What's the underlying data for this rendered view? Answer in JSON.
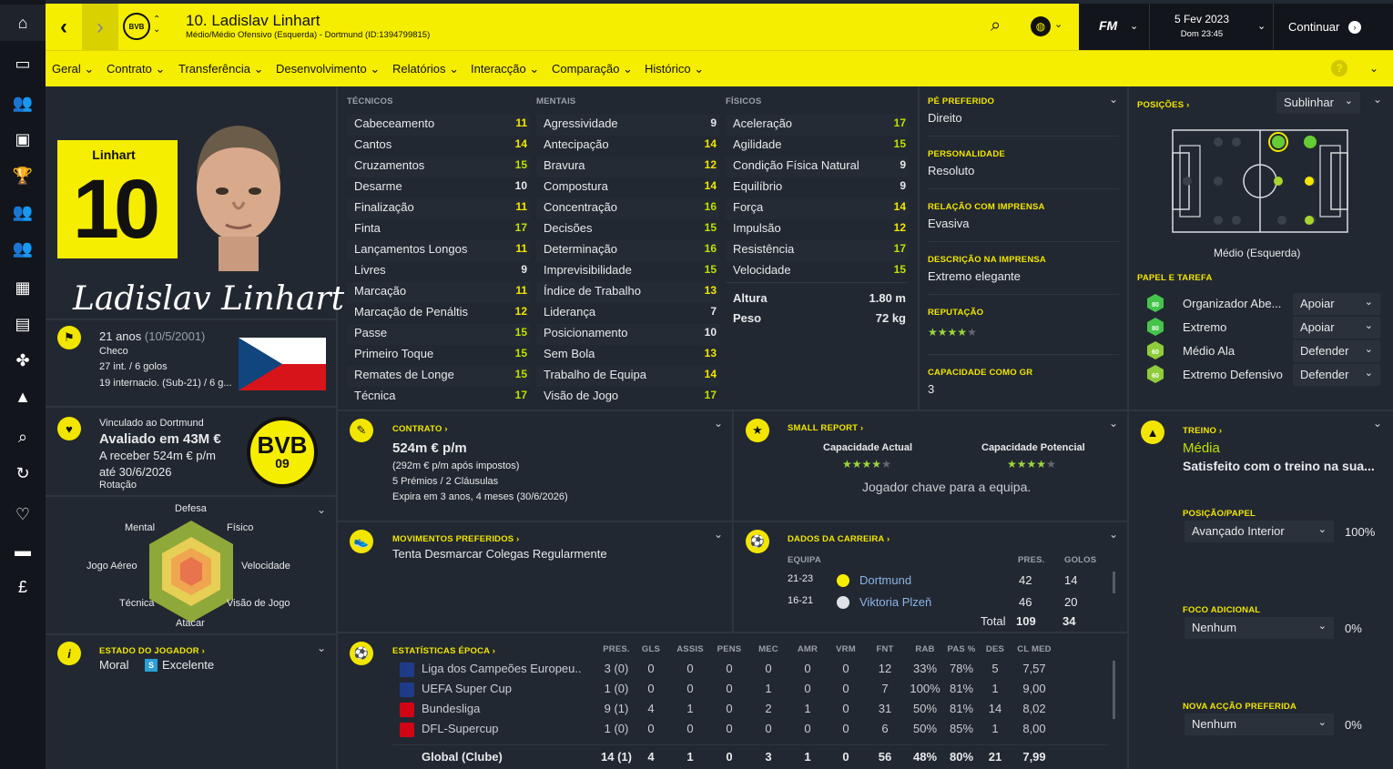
{
  "sidebar": {
    "icons": [
      "home-icon",
      "inbox-icon",
      "squad-icon",
      "screen-icon",
      "trophy-icon",
      "staff-icon",
      "team-icon",
      "board-icon",
      "news-icon",
      "scouting-icon",
      "training-icon",
      "search-icon",
      "transfer-icon",
      "club-icon",
      "finance-icon",
      "money-icon"
    ]
  },
  "header": {
    "title": "10. Ladislav Linhart",
    "subtitle": "Médio/Médio Ofensivo (Esquerda) - Dortmund (ID:1394799815)",
    "date": "5 Fev 2023",
    "time": "Dom 23:45",
    "continue": "Continuar",
    "fm": "FM",
    "club_badge": "BVB"
  },
  "nav": {
    "items": [
      "Geral",
      "Contrato",
      "Transferência",
      "Desenvolvimento",
      "Relatórios",
      "Interacção",
      "Comparação",
      "Histórico"
    ]
  },
  "profile": {
    "kit_name": "Linhart",
    "kit_number": "10",
    "signature": "Ladislav Linhart",
    "age": "21 anos",
    "dob": "(10/5/2001)",
    "nationality": "Checo",
    "caps": "27 int. / 6 golos",
    "youth": "19 internacio. (Sub-21) / 6 g...",
    "club_line": "Vinculado ao Dortmund",
    "value": "Avaliado em 43M €",
    "wage": "A receber 524m € p/m",
    "until": "até 30/6/2026",
    "status": "Rotação",
    "badge_text": "BVB",
    "badge_year": "09"
  },
  "radar": {
    "labels": [
      "Defesa",
      "Físico",
      "Velocidade",
      "Visão de Jogo",
      "Atacar",
      "Técnica",
      "Jogo Aéreo",
      "Mental"
    ]
  },
  "player_state": {
    "title": "ESTADO DO JOGADOR ›",
    "moral_label": "Moral",
    "moral_value": "Excelente",
    "moral_badge": "S"
  },
  "attributes": {
    "technical_title": "TÉCNICOS",
    "mental_title": "MENTAIS",
    "physical_title": "FÍSICOS",
    "technical": [
      [
        "Cabeceamento",
        "11"
      ],
      [
        "Cantos",
        "14"
      ],
      [
        "Cruzamentos",
        "15"
      ],
      [
        "Desarme",
        "10"
      ],
      [
        "Finalização",
        "11"
      ],
      [
        "Finta",
        "17"
      ],
      [
        "Lançamentos Longos",
        "11"
      ],
      [
        "Livres",
        "9"
      ],
      [
        "Marcação",
        "11"
      ],
      [
        "Marcação de Penáltis",
        "12"
      ],
      [
        "Passe",
        "15"
      ],
      [
        "Primeiro Toque",
        "15"
      ],
      [
        "Remates de Longe",
        "15"
      ],
      [
        "Técnica",
        "17"
      ]
    ],
    "mental": [
      [
        "Agressividade",
        "9"
      ],
      [
        "Antecipação",
        "14"
      ],
      [
        "Bravura",
        "12"
      ],
      [
        "Compostura",
        "14"
      ],
      [
        "Concentração",
        "16"
      ],
      [
        "Decisões",
        "15"
      ],
      [
        "Determinação",
        "16"
      ],
      [
        "Imprevisibilidade",
        "15"
      ],
      [
        "Índice de Trabalho",
        "13"
      ],
      [
        "Liderança",
        "7"
      ],
      [
        "Posicionamento",
        "10"
      ],
      [
        "Sem Bola",
        "13"
      ],
      [
        "Trabalho de Equipa",
        "14"
      ],
      [
        "Visão de Jogo",
        "17"
      ]
    ],
    "physical": [
      [
        "Aceleração",
        "17"
      ],
      [
        "Agilidade",
        "15"
      ],
      [
        "Condição Física Natural",
        "9"
      ],
      [
        "Equilíbrio",
        "9"
      ],
      [
        "Força",
        "14"
      ],
      [
        "Impulsão",
        "12"
      ],
      [
        "Resistência",
        "17"
      ],
      [
        "Velocidade",
        "15"
      ]
    ],
    "height_label": "Altura",
    "height": "1.80 m",
    "weight_label": "Peso",
    "weight": "72 kg"
  },
  "info": {
    "foot_title": "PÉ PREFERIDO",
    "foot": "Direito",
    "personality_title": "PERSONALIDADE",
    "personality": "Resoluto",
    "media_title": "RELAÇÃO COM IMPRENSA",
    "media": "Evasiva",
    "desc_title": "DESCRIÇÃO NA IMPRENSA",
    "desc": "Extremo elegante",
    "rep_title": "REPUTAÇÃO",
    "rep_stars": 4,
    "gk_title": "CAPACIDADE COMO GR",
    "gk": "3"
  },
  "positions": {
    "title": "POSIÇÕES ›",
    "highlight": "Sublinhar",
    "position_label": "Médio (Esquerda)",
    "roles_title": "PAPEL E TAREFA",
    "roles": [
      {
        "name": "Organizador Abe...",
        "duty": "Apoiar",
        "badge": "80"
      },
      {
        "name": "Extremo",
        "duty": "Apoiar",
        "badge": "80"
      },
      {
        "name": "Médio Ala",
        "duty": "Defender",
        "badge": "60"
      },
      {
        "name": "Extremo Defensivo",
        "duty": "Defender",
        "badge": "60"
      }
    ]
  },
  "contract": {
    "title": "CONTRATO ›",
    "wage": "524m € p/m",
    "net": "(292m € p/m após impostos)",
    "bonuses": "5 Prémios / 2 Cláusulas",
    "expires": "Expira em 3 anos, 4 meses (30/6/2026)"
  },
  "report": {
    "title": "SMALL REPORT ›",
    "ca_label": "Capacidade Actual",
    "pa_label": "Capacidade Potencial",
    "ca_stars": 4,
    "pa_stars": 4,
    "summary": "Jogador chave para a equipa."
  },
  "moves": {
    "title": "MOVIMENTOS PREFERIDOS ›",
    "item": "Tenta Desmarcar Colegas Regularmente"
  },
  "career": {
    "title": "DADOS DA CARREIRA ›",
    "h_team": "EQUIPA",
    "h_apps": "PRES.",
    "h_goals": "GOLOS",
    "rows": [
      {
        "season": "21-23",
        "team": "Dortmund",
        "apps": "42",
        "goals": "14"
      },
      {
        "season": "16-21",
        "team": "Viktoria Plzeň",
        "apps": "46",
        "goals": "20"
      }
    ],
    "total_label": "Total",
    "total_apps": "109",
    "total_goals": "34"
  },
  "season": {
    "title": "ESTATÍSTICAS ÉPOCA ›",
    "headers": [
      "PRES.",
      "GLS",
      "ASSIS",
      "PENS",
      "MEC",
      "AMR",
      "VRM",
      "FNT",
      "RAB",
      "PAS %",
      "DES",
      "CL MED"
    ],
    "rows": [
      [
        "Liga dos Campeões Europeu...",
        "3 (0)",
        "0",
        "0",
        "0",
        "0",
        "0",
        "0",
        "12",
        "33%",
        "78%",
        "5",
        "7,57"
      ],
      [
        "UEFA Super Cup",
        "1 (0)",
        "0",
        "0",
        "0",
        "1",
        "0",
        "0",
        "7",
        "100%",
        "81%",
        "1",
        "9,00"
      ],
      [
        "Bundesliga",
        "9 (1)",
        "4",
        "1",
        "0",
        "2",
        "1",
        "0",
        "31",
        "50%",
        "81%",
        "14",
        "8,02"
      ],
      [
        "DFL-Supercup",
        "1 (0)",
        "0",
        "0",
        "0",
        "0",
        "0",
        "0",
        "6",
        "50%",
        "85%",
        "1",
        "8,00"
      ]
    ],
    "total": [
      "Global (Clube)",
      "14 (1)",
      "4",
      "1",
      "0",
      "3",
      "1",
      "0",
      "56",
      "48%",
      "80%",
      "21",
      "7,99"
    ]
  },
  "training": {
    "title": "TREINO ›",
    "level": "Média",
    "note": "Satisfeito com o treino na sua...",
    "pos_title": "POSIÇÃO/PAPEL",
    "pos_value": "Avançado Interior",
    "pos_pct": "100%",
    "focus_title": "FOCO ADICIONAL",
    "focus_value": "Nenhum",
    "focus_pct": "0%",
    "pref_title": "NOVA ACÇÃO PREFERIDA",
    "pref_value": "Nenhum",
    "pref_pct": "0%"
  },
  "colors": {
    "accent": "#f6ee00",
    "bg": "#222831",
    "good": "#bfe100"
  }
}
